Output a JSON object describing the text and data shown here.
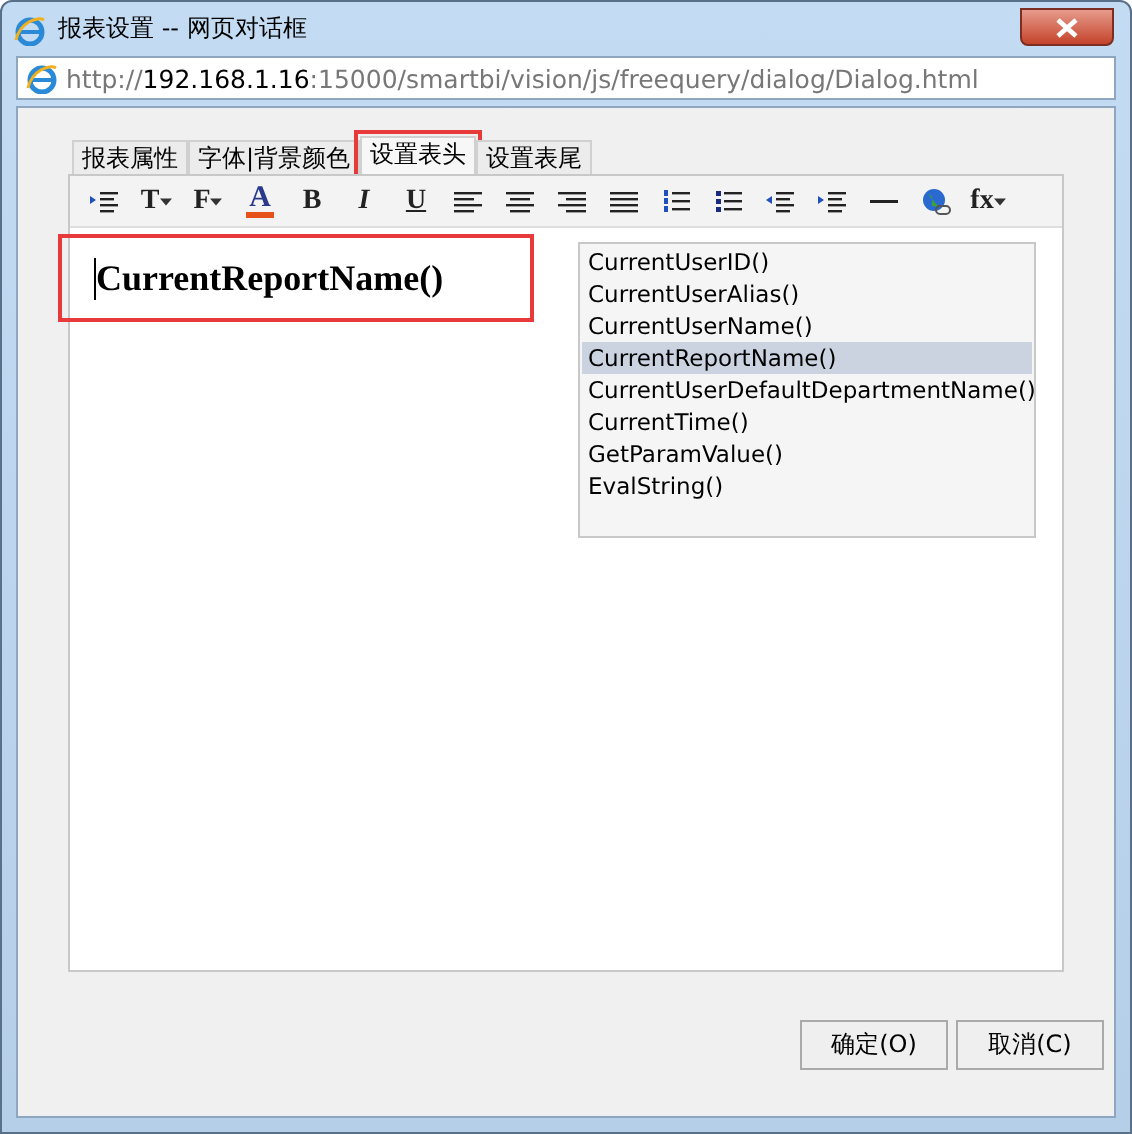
{
  "window": {
    "title": "报表设置 -- 网页对话框"
  },
  "address": {
    "prefix": "http://",
    "host": "192.168.1.16",
    "rest": ":15000/smartbi/vision/js/freequery/dialog/Dialog.html"
  },
  "tabs": [
    {
      "label": "报表属性",
      "selected": false,
      "highlighted": false
    },
    {
      "label": "字体|背景颜色",
      "selected": false,
      "highlighted": false
    },
    {
      "label": "设置表头",
      "selected": true,
      "highlighted": true
    },
    {
      "label": "设置表尾",
      "selected": false,
      "highlighted": false
    }
  ],
  "toolbar": [
    {
      "kind": "indent-list"
    },
    {
      "kind": "glyph",
      "text": "T",
      "caret": true
    },
    {
      "kind": "glyph",
      "text": "F",
      "caret": true
    },
    {
      "kind": "color",
      "text": "A"
    },
    {
      "kind": "glyph",
      "text": "B"
    },
    {
      "kind": "glyph",
      "text": "I"
    },
    {
      "kind": "glyph",
      "text": "U"
    },
    {
      "kind": "align-left"
    },
    {
      "kind": "align-center"
    },
    {
      "kind": "align-right"
    },
    {
      "kind": "align-justify"
    },
    {
      "kind": "ordered-list"
    },
    {
      "kind": "bullet-list"
    },
    {
      "kind": "outdent"
    },
    {
      "kind": "indent"
    },
    {
      "kind": "rule"
    },
    {
      "kind": "globe"
    },
    {
      "kind": "glyph",
      "text": "fx",
      "caret": true
    }
  ],
  "editor": {
    "text": "CurrentReportName()",
    "highlighted": true
  },
  "functions": [
    {
      "label": "CurrentUserID()",
      "selected": false
    },
    {
      "label": "CurrentUserAlias()",
      "selected": false
    },
    {
      "label": "CurrentUserName()",
      "selected": false
    },
    {
      "label": "CurrentReportName()",
      "selected": true
    },
    {
      "label": "CurrentUserDefaultDepartmentName()",
      "selected": false
    },
    {
      "label": "CurrentTime()",
      "selected": false
    },
    {
      "label": "GetParamValue()",
      "selected": false
    },
    {
      "label": "EvalString()",
      "selected": false
    }
  ],
  "buttons": [
    "确定(O)",
    "取消(C)"
  ]
}
